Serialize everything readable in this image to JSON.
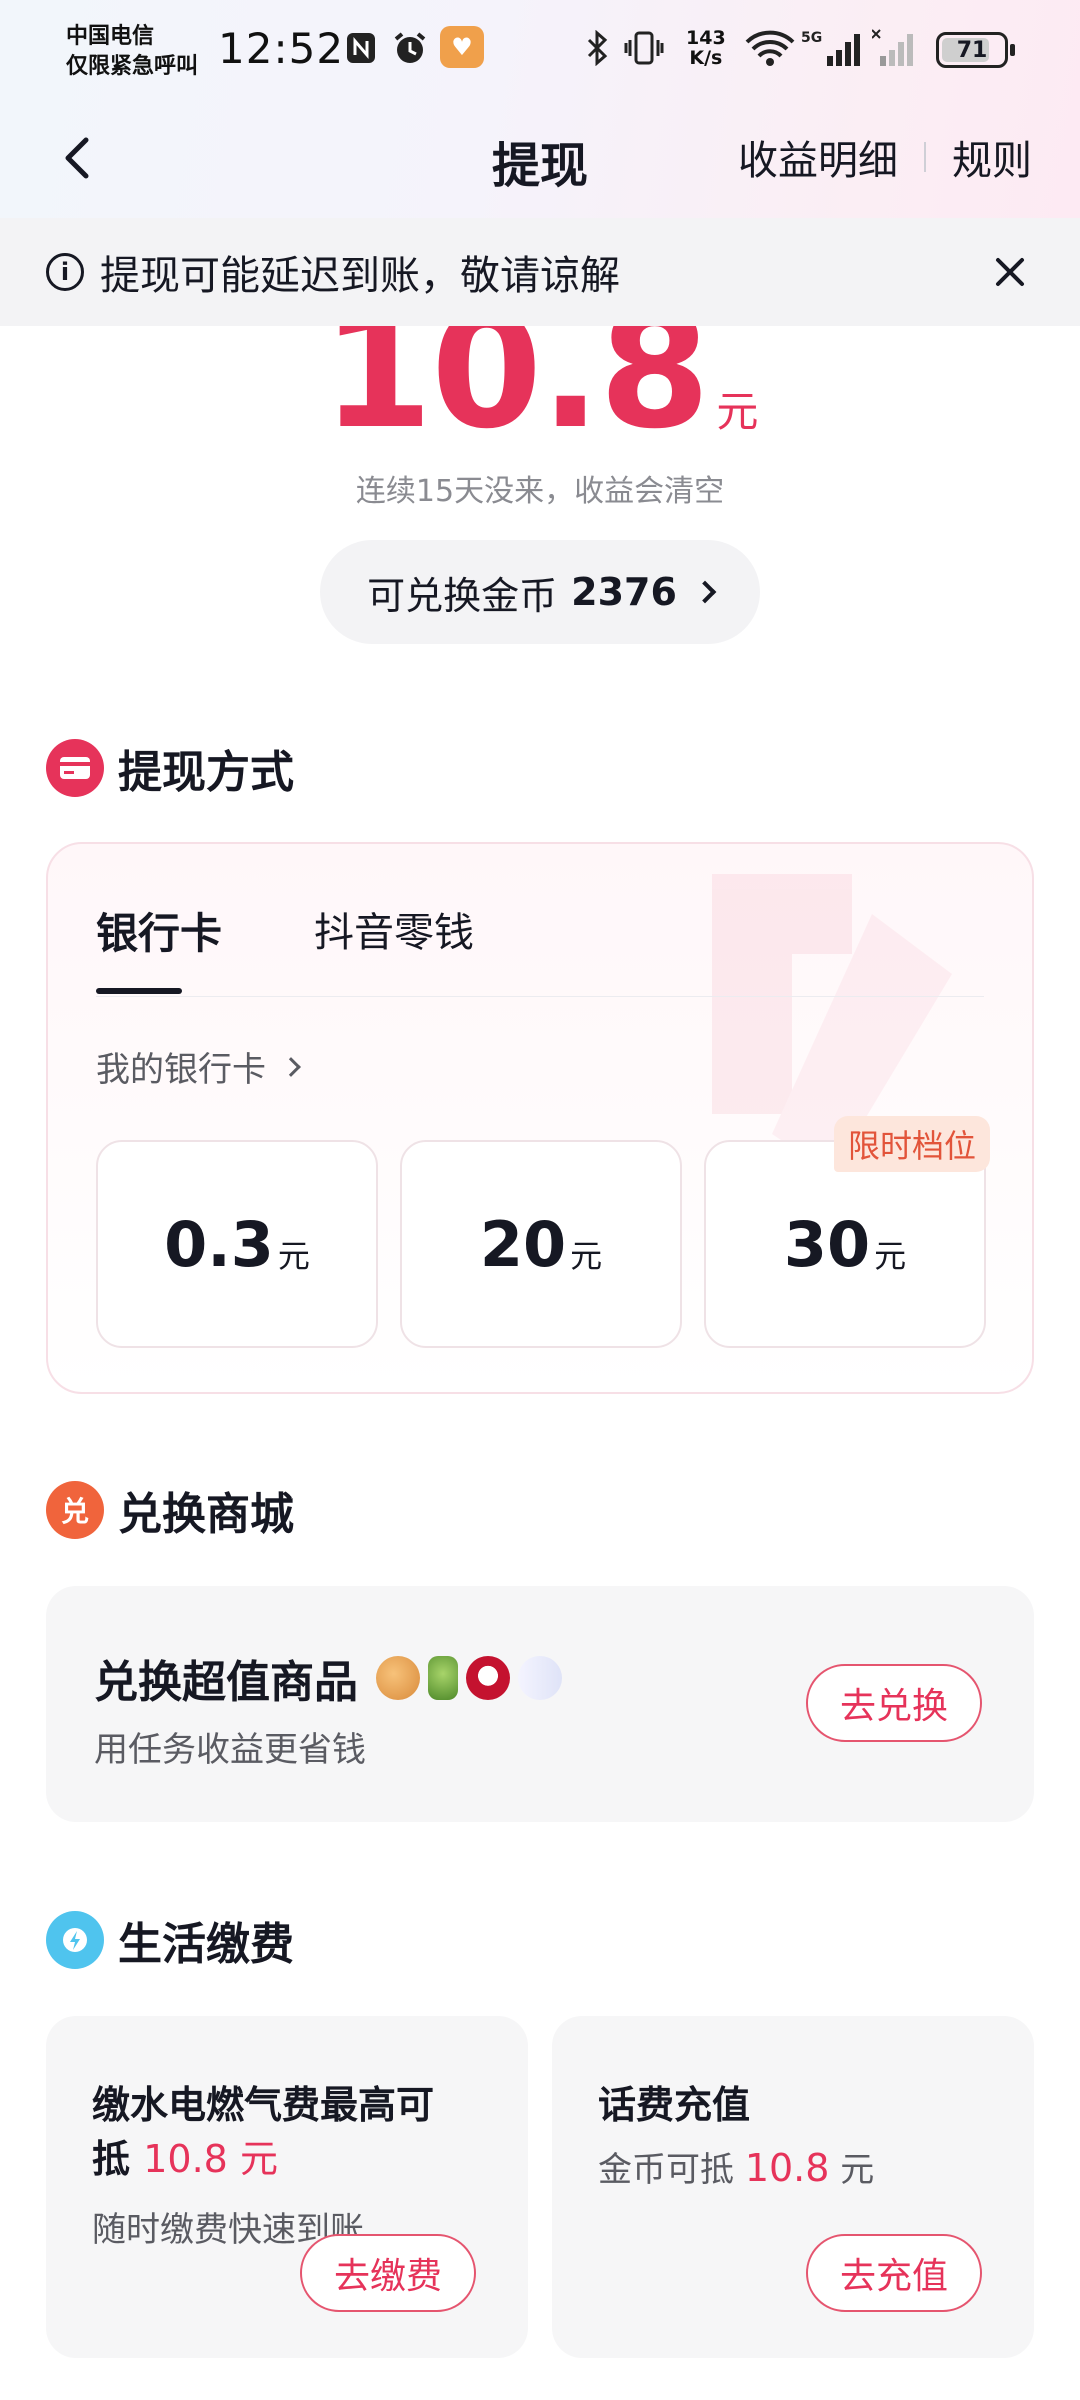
{
  "status_bar": {
    "carrier_line1": "中国电信",
    "carrier_line2": "仅限紧急呼叫",
    "time": "12:52",
    "net_speed_value": "143",
    "net_speed_unit": "K/s",
    "network": "5G",
    "battery": "71"
  },
  "header": {
    "title": "提现",
    "earnings_detail": "收益明细",
    "rules": "规则"
  },
  "notice": {
    "text": "提现可能延迟到账，敬请谅解"
  },
  "balance": {
    "amount": "10.8",
    "unit": "元",
    "hint": "连续15天没来，收益会清空",
    "coins_label": "可兑换金币",
    "coins_value": "2376"
  },
  "withdraw": {
    "section_title": "提现方式",
    "tabs": [
      {
        "label": "银行卡",
        "active": true
      },
      {
        "label": "抖音零钱",
        "active": false
      }
    ],
    "my_bank_card": "我的银行卡",
    "options": [
      {
        "value": "0.3",
        "unit": "元"
      },
      {
        "value": "20",
        "unit": "元"
      },
      {
        "value": "30",
        "unit": "元"
      }
    ],
    "limited_badge": "限时档位"
  },
  "mall": {
    "section_title": "兑换商城",
    "card_title": "兑换超值商品",
    "card_sub": "用任务收益更省钱",
    "button": "去兑换"
  },
  "life": {
    "section_title": "生活缴费",
    "utility": {
      "title_prefix": "缴水电燃气费最高可",
      "title_line2_prefix": "抵",
      "amount": "10.8 元",
      "sub": "随时缴费快速到账",
      "button": "去缴费"
    },
    "phone": {
      "title": "话费充值",
      "sub_prefix": "金币可抵",
      "amount": "10.8",
      "sub_suffix": "元",
      "button": "去充值"
    }
  },
  "colors": {
    "accent": "#e6335a",
    "badge_bg": "#fde6dc",
    "badge_text": "#e2543a"
  }
}
